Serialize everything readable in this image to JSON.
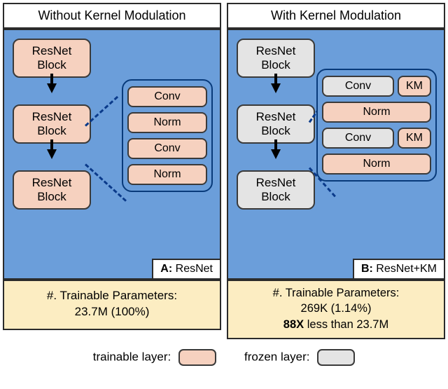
{
  "left": {
    "title": "Without Kernel Modulation",
    "blocks": [
      "ResNet\nBlock",
      "ResNet\nBlock",
      "ResNet\nBlock"
    ],
    "detail": [
      "Conv",
      "Norm",
      "Conv",
      "Norm"
    ],
    "corner_letter": "A:",
    "corner_text": "ResNet",
    "params_line1": "#. Trainable Parameters:",
    "params_line2": "23.7M (100%)"
  },
  "right": {
    "title": "With Kernel Modulation",
    "blocks": [
      "ResNet\nBlock",
      "ResNet\nBlock",
      "ResNet\nBlock"
    ],
    "detail_rows": [
      {
        "a": "Conv",
        "a_color": "grey",
        "b": "KM",
        "b_color": "peach"
      },
      {
        "a": "Norm",
        "a_color": "peach"
      },
      {
        "a": "Conv",
        "a_color": "grey",
        "b": "KM",
        "b_color": "peach"
      },
      {
        "a": "Norm",
        "a_color": "peach"
      }
    ],
    "corner_letter": "B:",
    "corner_text": "ResNet+KM",
    "params_line1": "#. Trainable Parameters:",
    "params_line2": "269K (1.14%)",
    "params_line3a": "88X",
    "params_line3b": " less than 23.7M"
  },
  "legend": {
    "trainable": "trainable layer:",
    "frozen": "frozen layer:"
  },
  "chart_data": {
    "type": "table",
    "title": "Trainable parameter comparison",
    "rows": [
      {
        "variant": "ResNet (A)",
        "trainable_params_M": 23.7,
        "percent": 100
      },
      {
        "variant": "ResNet+KM (B)",
        "trainable_params_M": 0.269,
        "percent": 1.14
      }
    ],
    "reduction_factor": 88,
    "colors": {
      "trainable": "#f6d1bf",
      "frozen": "#e4e4e4",
      "panel_bg": "#6b9eda",
      "info_bg": "#fcedc2"
    }
  }
}
